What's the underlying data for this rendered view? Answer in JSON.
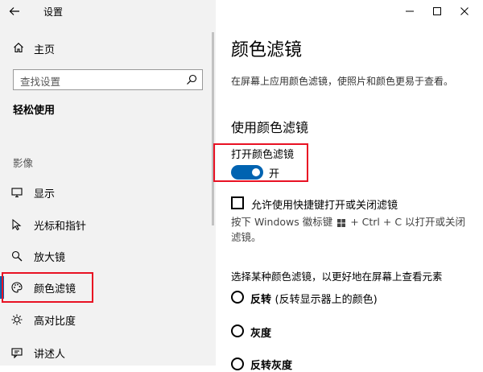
{
  "app": {
    "title": "设置"
  },
  "sidebar": {
    "home_label": "主页",
    "search_placeholder": "查找设置",
    "group_title": "轻松使用",
    "section_label": "影像",
    "items": [
      {
        "label": "显示",
        "icon": "monitor-icon"
      },
      {
        "label": "光标和指针",
        "icon": "cursor-icon"
      },
      {
        "label": "放大镜",
        "icon": "magnifier-icon"
      },
      {
        "label": "颜色滤镜",
        "icon": "palette-icon",
        "selected": true
      },
      {
        "label": "高对比度",
        "icon": "brightness-icon"
      },
      {
        "label": "讲述人",
        "icon": "narrator-icon"
      }
    ]
  },
  "main": {
    "title": "颜色滤镜",
    "description": "在屏幕上应用颜色滤镜，使照片和颜色更易于查看。",
    "section_heading": "使用颜色滤镜",
    "toggle": {
      "label": "打开颜色滤镜",
      "state_text": "开",
      "on": true
    },
    "shortcut_checkbox": {
      "label": "允许使用快捷键打开或关闭滤镜",
      "checked": false,
      "hint_before": "按下 Windows 徽标键",
      "hint_after": "+ Ctrl + C 以打开或关闭滤镜。"
    },
    "filter_select_title": "选择某种颜色滤镜，以更好地在屏幕上查看元素",
    "filters": [
      {
        "label": "反转",
        "desc": "(反转显示器上的颜色)"
      },
      {
        "label": "灰度",
        "desc": ""
      },
      {
        "label": "反转灰度",
        "desc": ""
      }
    ]
  },
  "colors": {
    "accent": "#0063b1",
    "highlight": "#e81123",
    "sidebar_bg": "#f2f2f2"
  }
}
